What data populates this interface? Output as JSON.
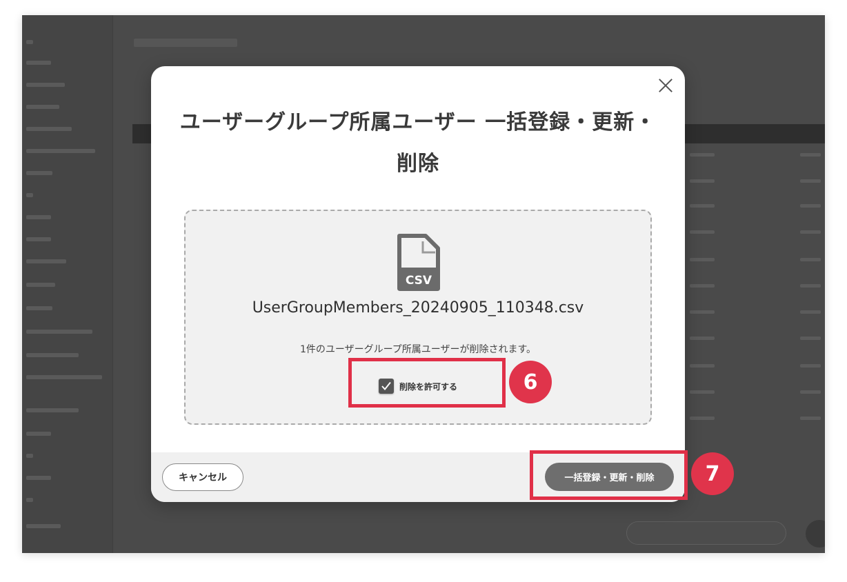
{
  "modal": {
    "title": "ユーザーグループ所属ユーザー 一括登録・更新・削除",
    "file": {
      "icon": "csv-file-icon",
      "icon_label": "CSV",
      "name": "UserGroupMembers_20240905_110348.csv"
    },
    "message": "1件のユーザーグループ所属ユーザーが削除されます。",
    "allow_delete": {
      "label": "削除を許可する",
      "checked": true
    },
    "footer": {
      "cancel_label": "キャンセル",
      "submit_label": "一括登録・更新・削除"
    }
  },
  "annotations": [
    {
      "step": "6",
      "color": "#e0344b"
    },
    {
      "step": "7",
      "color": "#e0344b"
    }
  ]
}
